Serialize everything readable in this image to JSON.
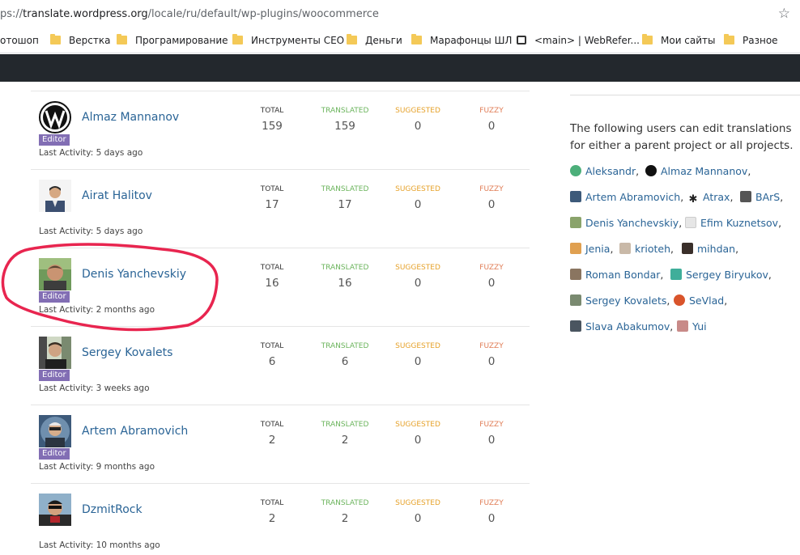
{
  "browser": {
    "url_prefix": "ps://",
    "url_host": "translate.wordpress.org",
    "url_path": "/locale/ru/default/wp-plugins/woocommerce",
    "star_icon": "star-icon"
  },
  "bookmarks": [
    {
      "label": "отошоп",
      "icon": "none"
    },
    {
      "label": "Верстка",
      "icon": "folder"
    },
    {
      "label": "Програмирование",
      "icon": "folder"
    },
    {
      "label": "Инструменты СЕО",
      "icon": "folder"
    },
    {
      "label": "Деньги",
      "icon": "folder"
    },
    {
      "label": "Марафонцы ШЛ",
      "icon": "folder"
    },
    {
      "label": "<main> | WebRefer...",
      "icon": "chat"
    },
    {
      "label": "Мои сайты",
      "icon": "folder"
    },
    {
      "label": "Разное",
      "icon": "folder"
    }
  ],
  "stat_labels": {
    "total": "TOTAL",
    "translated": "TRANSLATED",
    "suggested": "SUGGESTED",
    "fuzzy": "FUZZY"
  },
  "contributors": [
    {
      "name": "Almaz Mannanov",
      "badge": "Editor",
      "activity": "Last Activity: 5 days ago",
      "total": "159",
      "translated": "159",
      "suggested": "0",
      "fuzzy": "0"
    },
    {
      "name": "Airat Halitov",
      "badge": "",
      "activity": "Last Activity: 5 days ago",
      "total": "17",
      "translated": "17",
      "suggested": "0",
      "fuzzy": "0"
    },
    {
      "name": "Denis Yanchevskiy",
      "badge": "Editor",
      "activity": "Last Activity: 2 months ago",
      "total": "16",
      "translated": "16",
      "suggested": "0",
      "fuzzy": "0"
    },
    {
      "name": "Sergey Kovalets",
      "badge": "Editor",
      "activity": "Last Activity: 3 weeks ago",
      "total": "6",
      "translated": "6",
      "suggested": "0",
      "fuzzy": "0"
    },
    {
      "name": "Artem Abramovich",
      "badge": "Editor",
      "activity": "Last Activity: 9 months ago",
      "total": "2",
      "translated": "2",
      "suggested": "0",
      "fuzzy": "0"
    },
    {
      "name": "DzmitRock",
      "badge": "",
      "activity": "Last Activity: 10 months ago",
      "total": "2",
      "translated": "2",
      "suggested": "0",
      "fuzzy": "0"
    }
  ],
  "sidebar": {
    "description": "The following users can edit translations for either a parent project or all projects.",
    "editors": [
      {
        "name": "Aleksandr",
        "sep": ","
      },
      {
        "name": "Almaz Mannanov",
        "sep": ","
      },
      {
        "name": "Artem Abramovich",
        "sep": ","
      },
      {
        "name": "Atrax",
        "sep": ","
      },
      {
        "name": "BArS",
        "sep": ","
      },
      {
        "name": "Denis Yanchevskiy",
        "sep": ","
      },
      {
        "name": "Efim Kuznetsov",
        "sep": ","
      },
      {
        "name": "Jenia",
        "sep": ","
      },
      {
        "name": "krioteh",
        "sep": ","
      },
      {
        "name": "mihdan",
        "sep": ","
      },
      {
        "name": "Roman Bondar",
        "sep": ","
      },
      {
        "name": "Sergey Biryukov",
        "sep": ","
      },
      {
        "name": "Sergey Kovalets",
        "sep": ","
      },
      {
        "name": "SeVlad",
        "sep": ","
      },
      {
        "name": "Slava Abakumov",
        "sep": ","
      },
      {
        "name": "Yui",
        "sep": ""
      }
    ]
  },
  "colors": {
    "link": "#2a6496",
    "editor_badge": "#826eb4",
    "translated": "#6bb45c",
    "suggested": "#e6a22b",
    "fuzzy": "#e07c55",
    "annotation": "#e8254f"
  }
}
